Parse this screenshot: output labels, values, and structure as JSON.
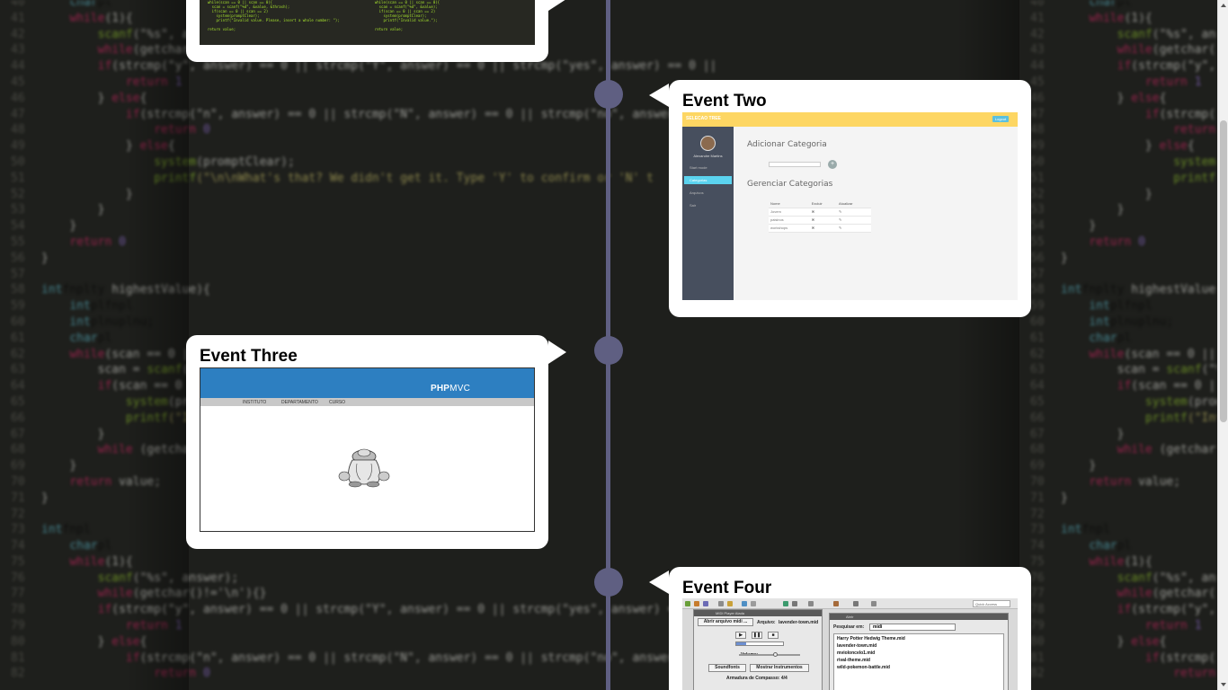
{
  "events": [
    {
      "id": "event-one",
      "title": ""
    },
    {
      "id": "event-two",
      "title": "Event Two"
    },
    {
      "id": "event-three",
      "title": "Event Three"
    },
    {
      "id": "event-four",
      "title": "Event Four"
    }
  ],
  "event_two_shot": {
    "brand": "SELECAO TREE",
    "top_button": "Logout",
    "user_name": "Alexandre Martins",
    "menu": [
      "Start mode",
      "Categorias",
      "Arquivos",
      "Sair"
    ],
    "heading_add": "Adicionar Categoria",
    "heading_manage": "Gerenciar Categorias",
    "table_header": [
      "Nome",
      "Excluir",
      "Atualizar"
    ],
    "table_rows": [
      "Jovem",
      "paisinos",
      "workshops"
    ]
  },
  "event_three_shot": {
    "logo_bold": "PHP",
    "logo_rest": "MVC",
    "nav": [
      "INSTITUTO",
      "DEPARTAMENTO",
      "CURSO"
    ]
  },
  "event_four_shot": {
    "search_placeholder": "Quick Access",
    "player_title": "MIDI Player Alada",
    "open_button": "Abrir arquivo midi ...",
    "file_label": "Arquivo:",
    "file_value": "lavender-town.mid",
    "volume_label": "Volume:",
    "soundfonts_button": "Soundfonts",
    "instruments_button": "Mostrar Instrumentos",
    "time_signature": "Armadura de Compasso:  4/4",
    "dialog_title": "Abrir",
    "search_in_label": "Pesquisar em:",
    "search_in_value": "midi",
    "files": [
      "Harry Potter Hedwig Theme.mid",
      "lavender-town.mid",
      "mvioloncelo1.mid",
      "rival-theme.mid",
      "wild-pokemon-battle.mid"
    ]
  },
  "colors": {
    "timeline": "#5f5f82",
    "page_background": "#1e1f1c",
    "card": "#ffffff"
  }
}
